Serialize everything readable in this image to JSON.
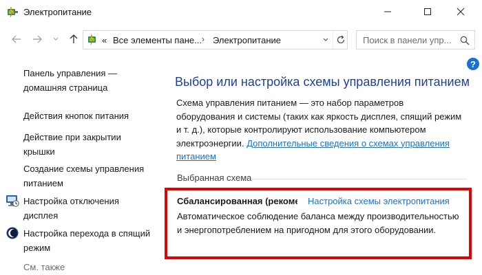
{
  "window": {
    "title": "Электропитание"
  },
  "address": {
    "segments": [
      "Все элементы пане...",
      "Электропитание"
    ],
    "overflow": "«"
  },
  "search": {
    "placeholder": "Поиск в панели упр..."
  },
  "sidebar": {
    "items": [
      {
        "label": "Панель управления — домашняя страница",
        "icon": null
      },
      {
        "label": "Действия кнопок питания",
        "icon": null
      },
      {
        "label": "Действие при закрытии крышки",
        "icon": null
      },
      {
        "label": "Создание схемы управления питанием",
        "icon": null
      },
      {
        "label": "Настройка отключения дисплея",
        "icon": "display-off-icon"
      },
      {
        "label": "Настройка перехода в спящий режим",
        "icon": "sleep-moon-icon"
      }
    ],
    "see_also": "См. также"
  },
  "main": {
    "help_label": "?",
    "heading": "Выбор или настройка схемы управления питанием",
    "description": "Схема управления питанием — это набор параметров оборудования и системы (таких как яркость дисплея, спящий режим и т. д.), которые контролируют использование компьютером электроэнергии.",
    "description_link": "Дополнительные сведения о схемах управления питанием",
    "selected_section": "Выбранная схема",
    "scheme": {
      "name": "Сбалансированная (рекомендуется)",
      "settings_link": "Настройка схемы электропитания",
      "description": "Автоматическое соблюдение баланса между производительностью и энергопотреблением на пригодном для этого оборудовании."
    }
  },
  "colors": {
    "heading": "#1e3f9b",
    "link": "#1a6fd1",
    "highlight_border": "#e30000"
  }
}
